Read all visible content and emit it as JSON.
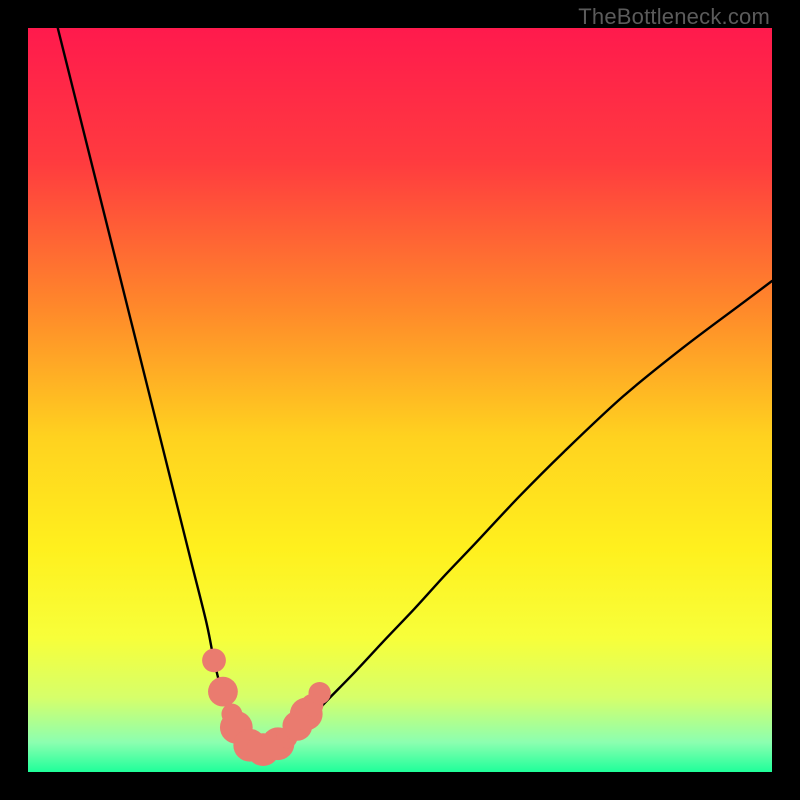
{
  "watermark": "TheBottleneck.com",
  "chart_data": {
    "type": "line",
    "title": "",
    "xlabel": "",
    "ylabel": "",
    "xlim": [
      0,
      100
    ],
    "ylim": [
      0,
      100
    ],
    "background_gradient": {
      "stops": [
        {
          "pos": 0.0,
          "color": "#ff1a4d"
        },
        {
          "pos": 0.18,
          "color": "#ff3b3f"
        },
        {
          "pos": 0.38,
          "color": "#ff8a2a"
        },
        {
          "pos": 0.55,
          "color": "#ffd21f"
        },
        {
          "pos": 0.7,
          "color": "#fff01e"
        },
        {
          "pos": 0.82,
          "color": "#f7ff3a"
        },
        {
          "pos": 0.9,
          "color": "#d6ff6a"
        },
        {
          "pos": 0.96,
          "color": "#8cffb0"
        },
        {
          "pos": 1.0,
          "color": "#1fff9a"
        }
      ]
    },
    "series": [
      {
        "name": "bottleneck-curve",
        "color": "#000000",
        "x": [
          4,
          6,
          8,
          10,
          12,
          14,
          16,
          18,
          20,
          22,
          24,
          25,
          26,
          27,
          28,
          29,
          30,
          31,
          32,
          33,
          34,
          36,
          38,
          40,
          44,
          48,
          52,
          56,
          60,
          66,
          72,
          80,
          88,
          96,
          100
        ],
        "y": [
          100,
          92,
          84,
          76,
          68,
          60,
          52,
          44,
          36,
          28,
          20,
          15,
          11,
          8,
          6,
          4.5,
          3.5,
          3.0,
          3.0,
          3.2,
          3.8,
          5.2,
          7.2,
          9.4,
          13.5,
          17.8,
          22.0,
          26.4,
          30.6,
          37.0,
          43.0,
          50.5,
          57.0,
          63.0,
          66.0
        ]
      }
    ],
    "markers": {
      "name": "highlight-dots",
      "color": "#ea7b6f",
      "points": [
        {
          "x": 25.0,
          "y": 15.0,
          "r": 1.6
        },
        {
          "x": 26.2,
          "y": 10.8,
          "r": 2.0
        },
        {
          "x": 27.4,
          "y": 7.8,
          "r": 1.4
        },
        {
          "x": 28.0,
          "y": 6.0,
          "r": 2.2
        },
        {
          "x": 29.8,
          "y": 3.6,
          "r": 2.2
        },
        {
          "x": 31.6,
          "y": 3.0,
          "r": 2.2
        },
        {
          "x": 33.6,
          "y": 3.8,
          "r": 2.2
        },
        {
          "x": 34.8,
          "y": 4.6,
          "r": 1.4
        },
        {
          "x": 36.2,
          "y": 6.2,
          "r": 2.0
        },
        {
          "x": 37.4,
          "y": 7.8,
          "r": 2.2
        },
        {
          "x": 38.2,
          "y": 9.0,
          "r": 1.5
        },
        {
          "x": 39.2,
          "y": 10.6,
          "r": 1.5
        }
      ]
    }
  }
}
